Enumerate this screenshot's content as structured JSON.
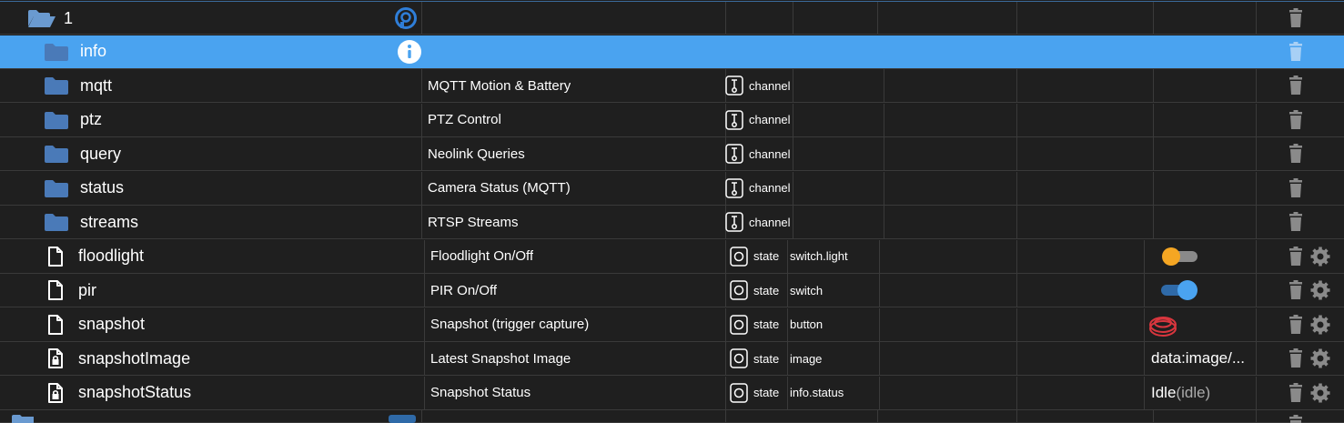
{
  "rows": [
    {
      "name": "1",
      "kind": "device-open",
      "desc": "",
      "type": "",
      "role": "",
      "value": "",
      "value_extra": ""
    },
    {
      "name": "info",
      "kind": "folder",
      "desc": "",
      "type": "",
      "role": "",
      "value": "",
      "value_extra": "",
      "selected": true
    },
    {
      "name": "mqtt",
      "kind": "folder",
      "desc": "MQTT Motion & Battery",
      "type": "channel",
      "role": "",
      "value": "",
      "value_extra": ""
    },
    {
      "name": "ptz",
      "kind": "folder",
      "desc": "PTZ Control",
      "type": "channel",
      "role": "",
      "value": "",
      "value_extra": ""
    },
    {
      "name": "query",
      "kind": "folder",
      "desc": "Neolink Queries",
      "type": "channel",
      "role": "",
      "value": "",
      "value_extra": ""
    },
    {
      "name": "status",
      "kind": "folder",
      "desc": "Camera Status (MQTT)",
      "type": "channel",
      "role": "",
      "value": "",
      "value_extra": ""
    },
    {
      "name": "streams",
      "kind": "folder",
      "desc": "RTSP Streams",
      "type": "channel",
      "role": "",
      "value": "",
      "value_extra": ""
    },
    {
      "name": "floodlight",
      "kind": "file",
      "desc": "Floodlight On/Off",
      "type": "state",
      "role": "switch.light",
      "value": "",
      "value_extra": "",
      "control": "toggle-off-orange"
    },
    {
      "name": "pir",
      "kind": "file",
      "desc": "PIR On/Off",
      "type": "state",
      "role": "switch",
      "value": "",
      "value_extra": "",
      "control": "toggle-on-blue"
    },
    {
      "name": "snapshot",
      "kind": "file",
      "desc": "Snapshot (trigger capture)",
      "type": "state",
      "role": "button",
      "value": "",
      "value_extra": "",
      "control": "button"
    },
    {
      "name": "snapshotImage",
      "kind": "file-lock",
      "desc": "Latest Snapshot Image",
      "type": "state",
      "role": "image",
      "value": "data:image/...",
      "value_extra": ""
    },
    {
      "name": "snapshotStatus",
      "kind": "file-lock",
      "desc": "Snapshot Status",
      "type": "state",
      "role": "info.status",
      "value": "Idle",
      "value_extra": "(idle)"
    }
  ],
  "colors": {
    "folder": "#4a7ab8",
    "selected": "#4aa3f0",
    "trash": "#8a8a8a",
    "orange": "#f5a623",
    "blue": "#4aa3f0",
    "red": "#d9363e"
  }
}
